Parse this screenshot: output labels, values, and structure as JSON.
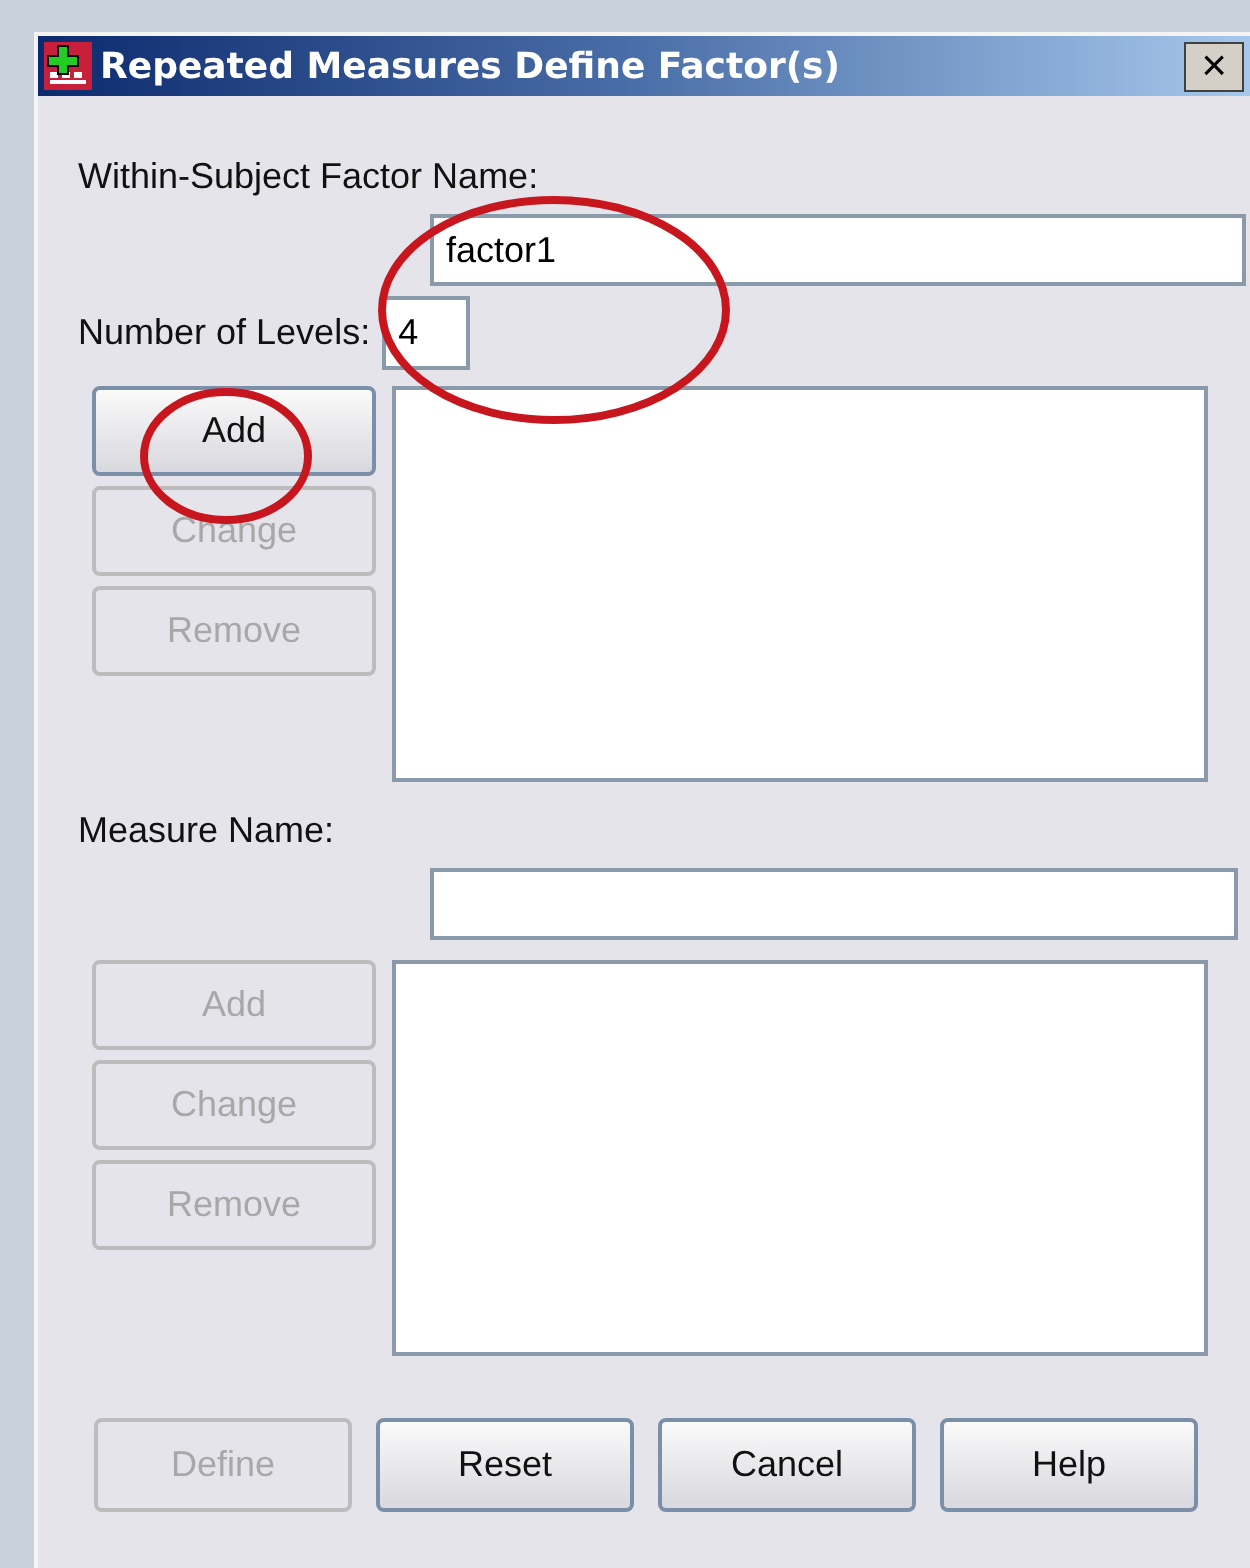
{
  "window": {
    "title": "Repeated Measures Define Factor(s)",
    "close": "×"
  },
  "factor": {
    "label": "Within-Subject Factor Name:",
    "name_value": "factor1",
    "levels_label": "Number of Levels:",
    "levels_value": "4",
    "buttons": [
      {
        "label": "Add",
        "disabled": false
      },
      {
        "label": "Change",
        "disabled": true
      },
      {
        "label": "Remove",
        "disabled": true
      }
    ]
  },
  "measure": {
    "label": "Measure Name:",
    "buttons": [
      {
        "label": "Add",
        "disabled": true
      },
      {
        "label": "Change",
        "disabled": true
      },
      {
        "label": "Remove",
        "disabled": true
      }
    ]
  },
  "footer_buttons": [
    {
      "label": "Define",
      "disabled": true
    },
    {
      "label": "Reset",
      "disabled": false
    },
    {
      "label": "Cancel",
      "disabled": false
    },
    {
      "label": "Help",
      "disabled": false
    }
  ],
  "annotations": [
    {
      "kind": "ellipse"
    },
    {
      "kind": "ellipse"
    }
  ]
}
